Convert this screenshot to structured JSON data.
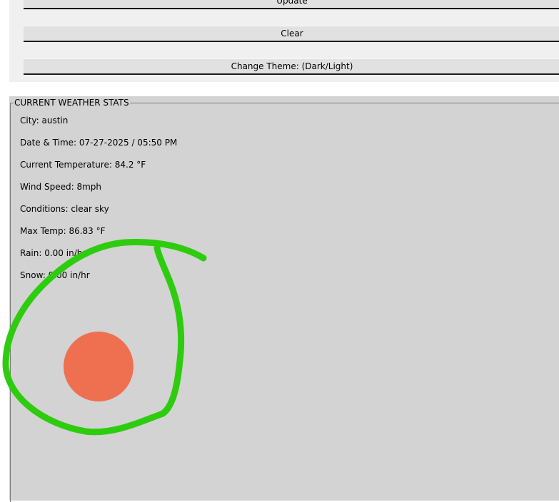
{
  "buttons": {
    "update_label": "Update",
    "clear_label": "Clear",
    "theme_label": "Change Theme: (Dark/Light)"
  },
  "stats": {
    "title": "CURRENT WEATHER STATS",
    "city": "City: austin",
    "datetime": "Date & Time: 07-27-2025 / 05:50 PM",
    "temperature": "Current Temperature: 84.2 °F",
    "wind": "Wind Speed: 8mph",
    "conditions": "Conditions: clear sky",
    "max_temp": "Max Temp: 86.83 °F",
    "rain": "Rain: 0.00 in/hr",
    "snow": "Snow: 0.00 in/hr"
  },
  "colors": {
    "panel_background": "#d3d3d3",
    "button_background": "#e1e1e1",
    "sun_icon": "#ee7050",
    "annotation_stroke": "#2ecc0e"
  },
  "icons": {
    "weather_icon": "sun-icon"
  }
}
